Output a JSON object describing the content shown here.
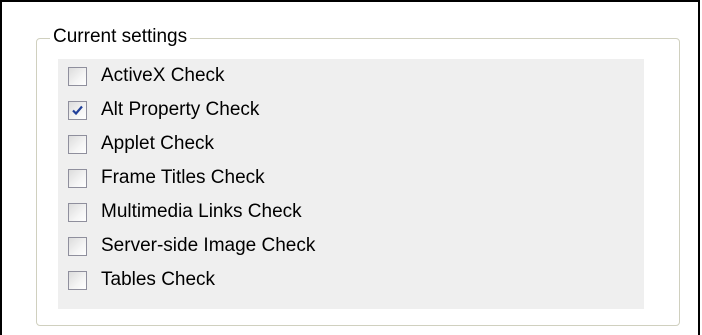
{
  "group": {
    "title": "Current settings"
  },
  "checks": [
    {
      "label": "ActiveX Check",
      "checked": false
    },
    {
      "label": "Alt Property Check",
      "checked": true
    },
    {
      "label": "Applet Check",
      "checked": false
    },
    {
      "label": "Frame Titles Check",
      "checked": false
    },
    {
      "label": "Multimedia Links Check",
      "checked": false
    },
    {
      "label": "Server-side Image Check",
      "checked": false
    },
    {
      "label": "Tables Check",
      "checked": false
    }
  ],
  "colors": {
    "checkmark": "#21409a",
    "panel_background": "#efefef",
    "groupbox_border": "#d0d0bf"
  }
}
